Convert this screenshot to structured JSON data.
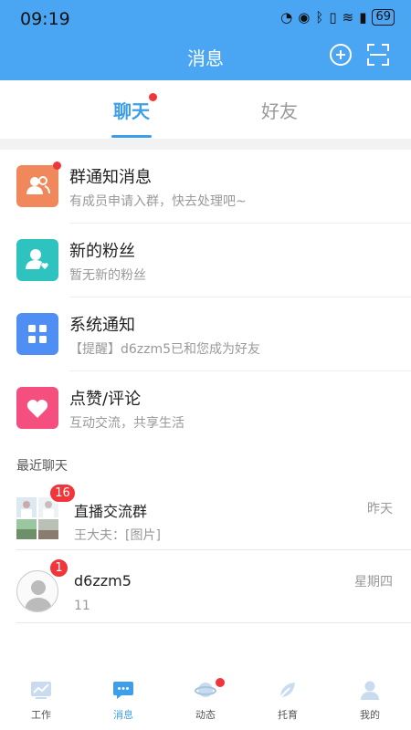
{
  "status_bar": {
    "time": "09:19",
    "battery": "69"
  },
  "header": {
    "title": "消息"
  },
  "tabs": [
    {
      "label": "聊天"
    },
    {
      "label": "好友"
    }
  ],
  "notices": [
    {
      "title": "群通知消息",
      "subtitle": "有成员申请入群，快去处理吧~",
      "color": "#f0885b"
    },
    {
      "title": "新的粉丝",
      "subtitle": "暂无新的粉丝",
      "color": "#2fc3c0"
    },
    {
      "title": "系统通知",
      "subtitle": "【提醒】d6zzm5已和您成为好友",
      "color": "#4f8ef2"
    },
    {
      "title": "点赞/评论",
      "subtitle": "互动交流，共享生活",
      "color": "#f54f7f"
    }
  ],
  "recent_label": "最近聊天",
  "chats": [
    {
      "name": "直播交流群",
      "message": "王大夫：[图片]",
      "time": "昨天",
      "badge": "16"
    },
    {
      "name": "d6zzm5",
      "message": "11",
      "time": "星期四",
      "badge": "1"
    }
  ],
  "nav": [
    {
      "label": "工作"
    },
    {
      "label": "消息"
    },
    {
      "label": "动态"
    },
    {
      "label": "托育"
    },
    {
      "label": "我的"
    }
  ],
  "colors": {
    "primary": "#4aa6f2",
    "accent": "#3d9ee9",
    "badge": "#f0353b"
  }
}
